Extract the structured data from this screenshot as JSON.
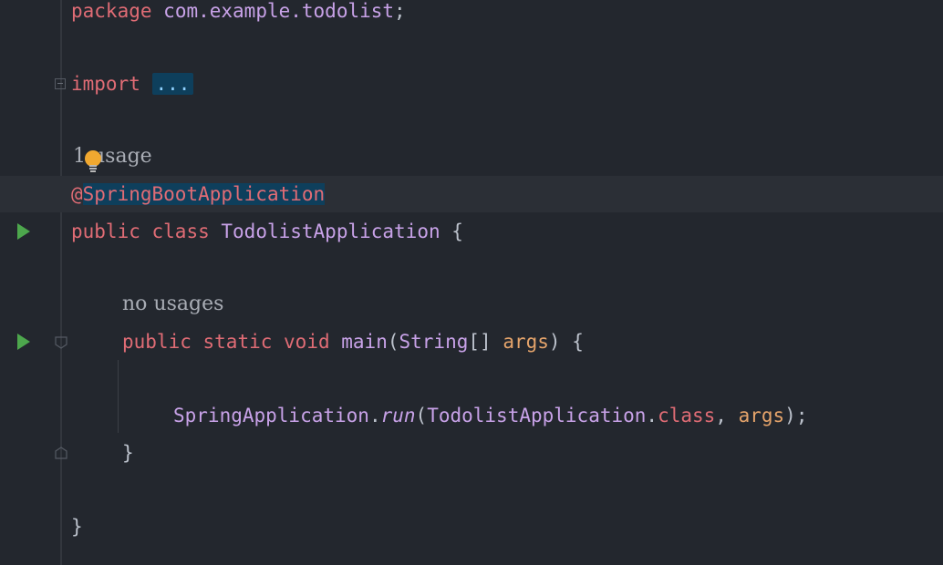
{
  "code": {
    "line_package": {
      "keyword": "package",
      "name": "com.example.todolist",
      "semicolon": ";"
    },
    "line_import": {
      "keyword": "import",
      "folded": "..."
    },
    "line_usage_hint": "1 usage",
    "line_annotation": {
      "at": "@",
      "name": "SpringBootApplication"
    },
    "line_class": {
      "public": "public",
      "class": "class",
      "name": "TodolistApplication",
      "brace": "{"
    },
    "line_main_hint": "no usages",
    "line_main": {
      "public": "public",
      "static": "static",
      "void": "void",
      "name": "main",
      "open": "(",
      "type": "String",
      "brackets": "[]",
      "param": "args",
      "close": ")",
      "brace": "{"
    },
    "line_run": {
      "cls": "SpringApplication",
      "dot": ".",
      "method": "run",
      "open": "(",
      "arg_cls": "TodolistApplication",
      "dot2": ".",
      "kw_class": "class",
      "comma": ",",
      "param": "args",
      "close": ");"
    },
    "line_close_method": "}",
    "line_close_class": "}"
  },
  "icons": {
    "run_class": "run-icon",
    "run_main": "run-icon",
    "intention": "lightbulb-icon",
    "fold_import": "fold-icon",
    "fold_main": "fold-icon"
  },
  "colors": {
    "background": "#23272e",
    "keyword": "#e06c75",
    "identifier": "#c8a2e8",
    "parameter": "#e5a46b",
    "run": "#4da74d",
    "bulb": "#f0a830",
    "selection": "#0e3f5c"
  }
}
